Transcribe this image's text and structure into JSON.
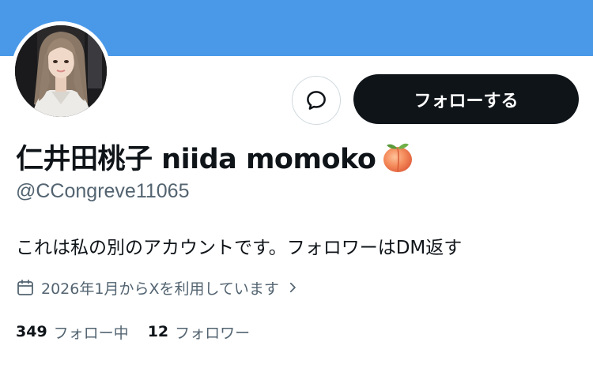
{
  "profile": {
    "display_name": "仁井田桃子 niida momoko",
    "name_emoji": "peach-icon",
    "handle": "@CCongreve11065",
    "bio": "これは私の別のアカウントです。フォロワーはDM返す",
    "joined": "2026年1月からXを利用しています",
    "following_count": "349",
    "following_label": "フォロー中",
    "followers_count": "12",
    "followers_label": "フォロワー"
  },
  "actions": {
    "follow_label": "フォローする",
    "message_icon": "message-icon"
  },
  "colors": {
    "banner": "#4a99e9",
    "primary_text": "#0f1419",
    "secondary_text": "#536471",
    "follow_button_bg": "#0f1419",
    "border": "#cfd9de"
  }
}
